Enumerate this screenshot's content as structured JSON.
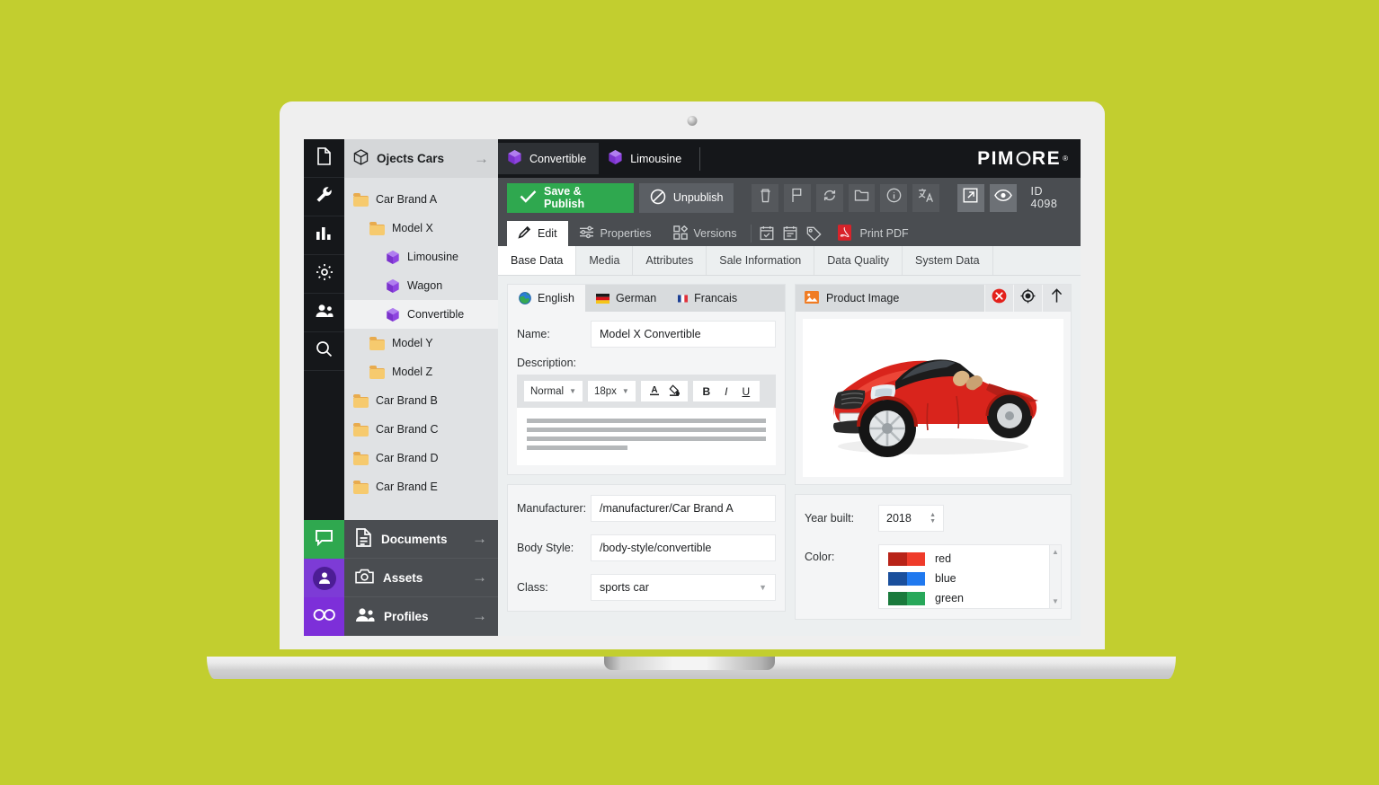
{
  "background_color": "#c2ce2f",
  "brand": {
    "name": "PIMCORE",
    "trademark": "®"
  },
  "icon_rail": {
    "items": [
      {
        "name": "document-icon",
        "label": "Documents"
      },
      {
        "name": "wrench-icon",
        "label": "Tools"
      },
      {
        "name": "chart-bar-icon",
        "label": "Reports"
      },
      {
        "name": "gear-icon",
        "label": "Settings"
      },
      {
        "name": "users-icon",
        "label": "Users"
      },
      {
        "name": "search-icon",
        "label": "Search"
      }
    ],
    "bottom_items": [
      {
        "name": "chat-icon",
        "label": "Chat",
        "color": "#2fa84f"
      },
      {
        "name": "person-badge-icon",
        "label": "Profile",
        "color": "#7d3bd6"
      },
      {
        "name": "infinity-icon",
        "label": "Infinity",
        "color": "#7d2fd9"
      }
    ]
  },
  "tree": {
    "title": "Ojects Cars",
    "header_icon": "cube-outline-icon",
    "header_arrow": "arrow-right-icon",
    "items": [
      {
        "label": "Car Brand A",
        "icon": "folder-icon",
        "indent": 0,
        "selected": false
      },
      {
        "label": "Model X",
        "icon": "folder-icon",
        "indent": 1,
        "selected": false
      },
      {
        "label": "Limousine",
        "icon": "cube-icon",
        "indent": 2,
        "selected": false
      },
      {
        "label": "Wagon",
        "icon": "cube-icon",
        "indent": 2,
        "selected": false
      },
      {
        "label": "Convertible",
        "icon": "cube-icon",
        "indent": 2,
        "selected": true
      },
      {
        "label": "Model Y",
        "icon": "folder-icon",
        "indent": 1,
        "selected": false
      },
      {
        "label": "Model Z",
        "icon": "folder-icon",
        "indent": 1,
        "selected": false
      },
      {
        "label": "Car Brand B",
        "icon": "folder-icon",
        "indent": 0,
        "selected": false
      },
      {
        "label": "Car Brand C",
        "icon": "folder-icon",
        "indent": 0,
        "selected": false
      },
      {
        "label": "Car Brand D",
        "icon": "folder-icon",
        "indent": 0,
        "selected": false
      },
      {
        "label": "Car Brand E",
        "icon": "folder-icon",
        "indent": 0,
        "selected": false
      }
    ]
  },
  "nav_strip": {
    "items": [
      {
        "label": "Documents",
        "icon": "document-icon",
        "arrow": "arrow-right-icon"
      },
      {
        "label": "Assets",
        "icon": "camera-icon",
        "arrow": "arrow-right-icon"
      },
      {
        "label": "Profiles",
        "icon": "users-icon",
        "arrow": "arrow-right-icon"
      }
    ]
  },
  "document_tabs": [
    {
      "label": "Convertible",
      "icon": "cube-icon",
      "active": true
    },
    {
      "label": "Limousine",
      "icon": "cube-icon",
      "active": false
    }
  ],
  "action_bar": {
    "save_label": "Save & Publish",
    "save_icon": "check-icon",
    "save_color": "#2fa84f",
    "unpublish_label": "Unpublish",
    "unpublish_icon": "no-entry-icon",
    "icon_buttons": [
      {
        "name": "trash-icon"
      },
      {
        "name": "flag-icon"
      },
      {
        "name": "reload-icon"
      },
      {
        "name": "folder-icon"
      },
      {
        "name": "info-icon"
      },
      {
        "name": "translate-icon"
      }
    ],
    "icon_buttons_right": [
      {
        "name": "open-external-icon"
      },
      {
        "name": "eye-icon"
      }
    ],
    "id_label": "ID  4098"
  },
  "sub_tabs": [
    {
      "label": "Edit",
      "icon": "pencil-icon",
      "active": true
    },
    {
      "label": "Properties",
      "icon": "sliders-icon",
      "active": false
    },
    {
      "label": "Versions",
      "icon": "blocks-icon",
      "active": false
    }
  ],
  "sub_tab_icons": [
    {
      "name": "schedule-check-icon"
    },
    {
      "name": "notes-icon"
    },
    {
      "name": "tag-icon"
    }
  ],
  "print_pdf": {
    "label": "Print PDF",
    "icon": "pdf-icon",
    "color": "#d8232a"
  },
  "content_tabs": [
    {
      "label": "Base Data",
      "active": true
    },
    {
      "label": "Media",
      "active": false
    },
    {
      "label": "Attributes",
      "active": false
    },
    {
      "label": "Sale Information",
      "active": false
    },
    {
      "label": "Data Quality",
      "active": false
    },
    {
      "label": "System Data",
      "active": false
    }
  ],
  "language_tabs": [
    {
      "label": "English",
      "icon": "globe-icon",
      "active": true
    },
    {
      "label": "German",
      "icon": "flag-de-icon",
      "active": false
    },
    {
      "label": "Francais",
      "icon": "flag-fr-icon",
      "active": false
    }
  ],
  "form": {
    "name": {
      "label": "Name:",
      "value": "Model X Convertible"
    },
    "description": {
      "label": "Description:"
    },
    "manufacturer": {
      "label": "Manufacturer:",
      "value": "/manufacturer/Car Brand A"
    },
    "body_style": {
      "label": "Body Style:",
      "value": "/body-style/convertible"
    },
    "class": {
      "label": "Class:",
      "value": "sports car",
      "caret": "▼"
    },
    "year_built": {
      "label": "Year built:",
      "value": "2018"
    },
    "color": {
      "label": "Color:"
    }
  },
  "rte": {
    "style_select": {
      "value": "Normal",
      "caret": "▼"
    },
    "size_select": {
      "value": "18px",
      "caret": "▼"
    },
    "buttons": [
      {
        "name": "font-color-icon",
        "glyph": "A"
      },
      {
        "name": "highlight-color-icon",
        "glyph": "▲"
      },
      {
        "name": "bold-icon",
        "glyph": "B"
      },
      {
        "name": "italic-icon",
        "glyph": "I"
      },
      {
        "name": "underline-icon",
        "glyph": "U"
      }
    ],
    "placeholder_lines": [
      100,
      100,
      100,
      42
    ]
  },
  "image_panel": {
    "title": "Product Image",
    "title_icon": "image-icon",
    "buttons": [
      {
        "name": "remove-image-button",
        "icon": "close-circle-icon",
        "color": "#e3211b"
      },
      {
        "name": "target-button",
        "icon": "crosshair-icon"
      },
      {
        "name": "upload-button",
        "icon": "arrow-up-icon"
      }
    ],
    "image_alt": "red convertible sports car"
  },
  "colors": {
    "items": [
      {
        "name": "red",
        "dark": "#b82318",
        "light": "#ef3b2a"
      },
      {
        "name": "blue",
        "dark": "#1a4f9c",
        "light": "#2079ef"
      },
      {
        "name": "green",
        "dark": "#1a7a3c",
        "light": "#28a85a"
      }
    ],
    "scroll_up": "▲",
    "scroll_down": "▼"
  }
}
